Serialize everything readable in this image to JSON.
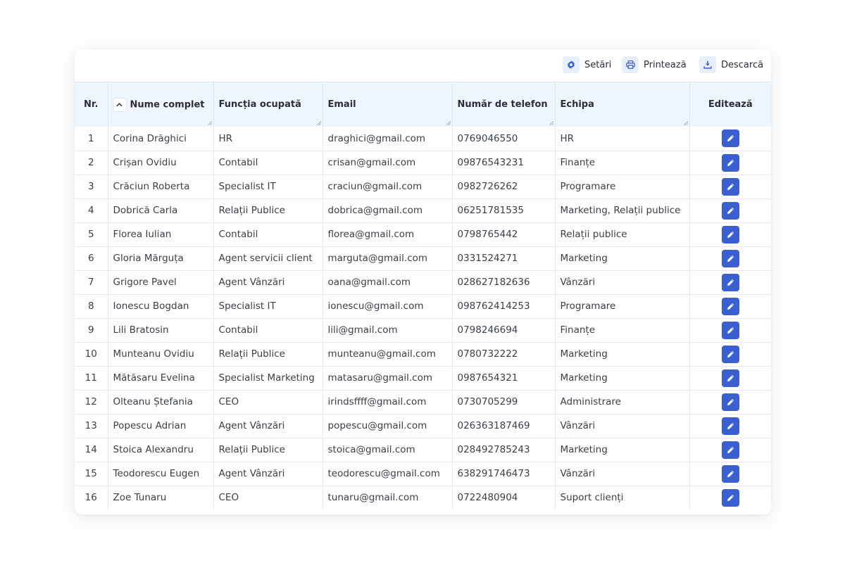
{
  "toolbar": {
    "settings_label": "Setări",
    "print_label": "Printează",
    "download_label": "Descarcă"
  },
  "columns": {
    "nr": "Nr.",
    "name": "Nume complet",
    "role": "Funcția ocupată",
    "email": "Email",
    "phone": "Număr de telefon",
    "team": "Echipa",
    "edit": "Editează"
  },
  "rows": [
    {
      "nr": "1",
      "name": "Corina Drăghici",
      "role": "HR",
      "email": "draghici@gmail.com",
      "phone": "0769046550",
      "team": "HR"
    },
    {
      "nr": "2",
      "name": "Crișan Ovidiu",
      "role": "Contabil",
      "email": "crisan@gmail.com",
      "phone": "09876543231",
      "team": "Finanțe"
    },
    {
      "nr": "3",
      "name": "Crăciun Roberta",
      "role": "Specialist IT",
      "email": "craciun@gmail.com",
      "phone": "0982726262",
      "team": "Programare"
    },
    {
      "nr": "4",
      "name": "Dobrică Carla",
      "role": "Relații Publice",
      "email": "dobrica@gmail.com",
      "phone": "06251781535",
      "team": "Marketing, Relații publice"
    },
    {
      "nr": "5",
      "name": "Florea Iulian",
      "role": "Contabil",
      "email": "florea@gmail.com",
      "phone": "0798765442",
      "team": "Relații publice"
    },
    {
      "nr": "6",
      "name": "Gloria Mărguța",
      "role": "Agent servicii client",
      "email": "marguta@gmail.com",
      "phone": "0331524271",
      "team": "Marketing"
    },
    {
      "nr": "7",
      "name": "Grigore Pavel",
      "role": "Agent Vânzări",
      "email": "oana@gmail.com",
      "phone": "028627182636",
      "team": "Vânzări"
    },
    {
      "nr": "8",
      "name": "Ionescu Bogdan",
      "role": "Specialist IT",
      "email": "ionescu@gmail.com",
      "phone": "098762414253",
      "team": "Programare"
    },
    {
      "nr": "9",
      "name": "Lili Bratosin",
      "role": "Contabil",
      "email": "lili@gmail.com",
      "phone": "0798246694",
      "team": "Finanțe"
    },
    {
      "nr": "10",
      "name": "Munteanu Ovidiu",
      "role": "Relații Publice",
      "email": "munteanu@gmail.com",
      "phone": "0780732222",
      "team": "Marketing"
    },
    {
      "nr": "11",
      "name": "Mătăsaru Evelina",
      "role": "Specialist Marketing",
      "email": "matasaru@gmail.com",
      "phone": "0987654321",
      "team": "Marketing"
    },
    {
      "nr": "12",
      "name": "Olteanu Ștefania",
      "role": "CEO",
      "email": "irindsffff@gmail.com",
      "phone": "0730705299",
      "team": "Administrare"
    },
    {
      "nr": "13",
      "name": "Popescu Adrian",
      "role": "Agent Vânzări",
      "email": "popescu@gmail.com",
      "phone": "026363187469",
      "team": "Vânzări"
    },
    {
      "nr": "14",
      "name": "Stoica Alexandru",
      "role": "Relații Publice",
      "email": "stoica@gmail.com",
      "phone": "028492785243",
      "team": "Marketing"
    },
    {
      "nr": "15",
      "name": "Teodorescu Eugen",
      "role": "Agent Vânzări",
      "email": "teodorescu@gmail.com",
      "phone": "638291746473",
      "team": "Vânzări"
    },
    {
      "nr": "16",
      "name": "Zoe Tunaru",
      "role": "CEO",
      "email": "tunaru@gmail.com",
      "phone": "0722480904",
      "team": "Suport clienți"
    }
  ],
  "icons": {
    "settings": "gear-icon",
    "print": "printer-icon",
    "download": "download-icon",
    "sort": "chevron-up-icon",
    "edit": "pencil-icon"
  },
  "colors": {
    "accent": "#3a5fd0",
    "header_bg": "#eef5fd",
    "icon_bg": "#e8eefb"
  }
}
